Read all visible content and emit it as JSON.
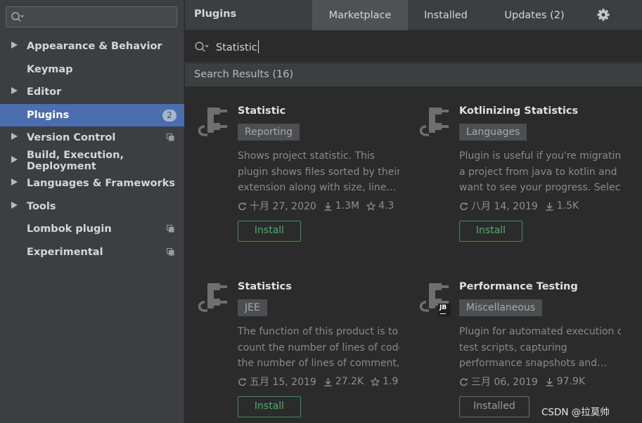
{
  "sidebar": {
    "search_placeholder": "",
    "items": [
      {
        "label": "Appearance & Behavior"
      },
      {
        "label": "Keymap"
      },
      {
        "label": "Editor"
      },
      {
        "label": "Plugins",
        "badge": "2"
      },
      {
        "label": "Version Control"
      },
      {
        "label": "Build, Execution, Deployment"
      },
      {
        "label": "Languages & Frameworks"
      },
      {
        "label": "Tools"
      },
      {
        "label": "Lombok plugin"
      },
      {
        "label": "Experimental"
      }
    ]
  },
  "header": {
    "title": "Plugins",
    "tabs": [
      {
        "label": "Marketplace"
      },
      {
        "label": "Installed"
      },
      {
        "label": "Updates (2)"
      }
    ]
  },
  "search": {
    "value": "Statistic"
  },
  "results": {
    "label": "Search Results (16)"
  },
  "plugins": [
    {
      "name": "Statistic",
      "tag": "Reporting",
      "desc": [
        "Shows project statistic. This",
        "plugin shows files sorted by their",
        "extension along with size, line…"
      ],
      "date": "十月 27, 2020",
      "downloads": "1.3M",
      "rating": "4.3",
      "button": "Install"
    },
    {
      "name": "Kotlinizing Statistics",
      "tag": "Languages",
      "desc": [
        "Plugin is useful if you're migrating",
        "a project from java to kotlin and",
        "want to see your progress. Select…"
      ],
      "date": "八月 14, 2019",
      "downloads": "1.5K",
      "rating": "",
      "button": "Install"
    },
    {
      "name": "Statistics",
      "tag": "JEE",
      "desc": [
        "The function of this product is to",
        "count the number of lines of code,",
        "the number of lines of comment,…"
      ],
      "date": "五月 15, 2019",
      "downloads": "27.2K",
      "rating": "1.9",
      "button": "Install"
    },
    {
      "name": "Performance Testing",
      "tag": "Miscellaneous",
      "desc": [
        "Plugin for automated execution of",
        "test scripts, capturing",
        "performance snapshots and…"
      ],
      "date": "三月 06, 2019",
      "downloads": "97.9K",
      "rating": "",
      "button": "Installed",
      "vendor_badge": "JB"
    }
  ],
  "watermark": "CSDN @拉莫帅"
}
